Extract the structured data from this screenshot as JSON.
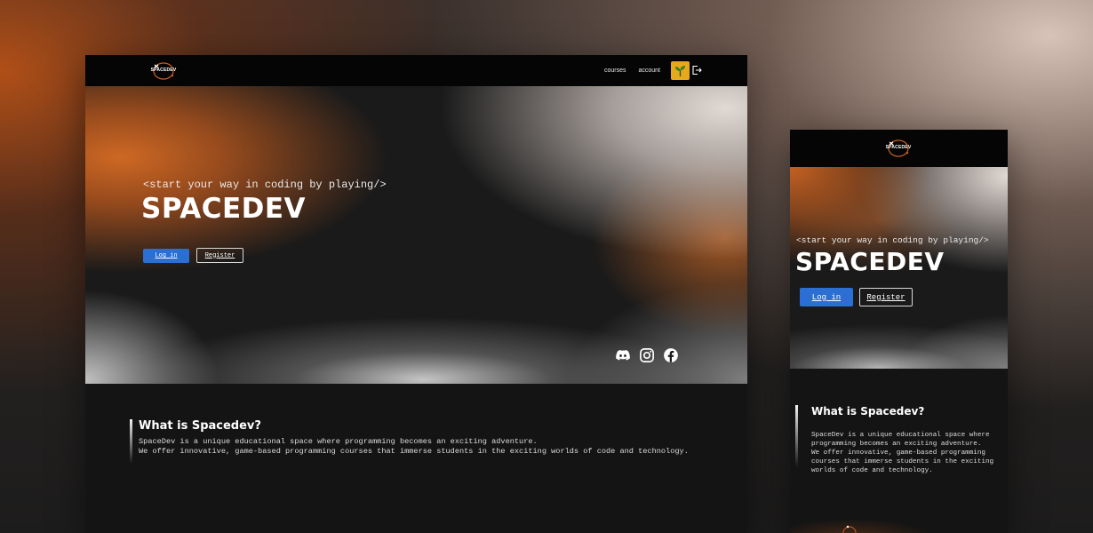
{
  "desktop": {
    "logo": "SPACEDEV",
    "nav": {
      "courses": "courses",
      "account": "account"
    },
    "hero": {
      "tagline": "<start your way in coding by playing/>",
      "title": "SPACEDEV",
      "login": "Log in",
      "register": "Register"
    },
    "socials": [
      "discord-icon",
      "instagram-icon",
      "facebook-icon"
    ],
    "about": {
      "title": "What is Spacedev?",
      "line1": "SpaceDev is a unique educational space where programming becomes an exciting adventure.",
      "line2": "We offer innovative, game-based programming courses that immerse students in the exciting worlds of code and technology."
    }
  },
  "mobile": {
    "logo": "SPACEDEV",
    "hero": {
      "tagline": "<start your way in coding by playing/>",
      "title": "SPACEDEV",
      "login": "Log in",
      "register": "Register"
    },
    "about": {
      "title": "What is Spacedev?",
      "line1": "SpaceDev is a unique educational space where programming becomes an exciting adventure.",
      "line2": "We offer innovative, game-based programming courses that immerse students in the exciting worlds of code and technology."
    }
  },
  "colors": {
    "accent_blue": "#2a6fd1",
    "accent_orange": "#c85f20",
    "avatar_yellow": "#e6a91b"
  }
}
